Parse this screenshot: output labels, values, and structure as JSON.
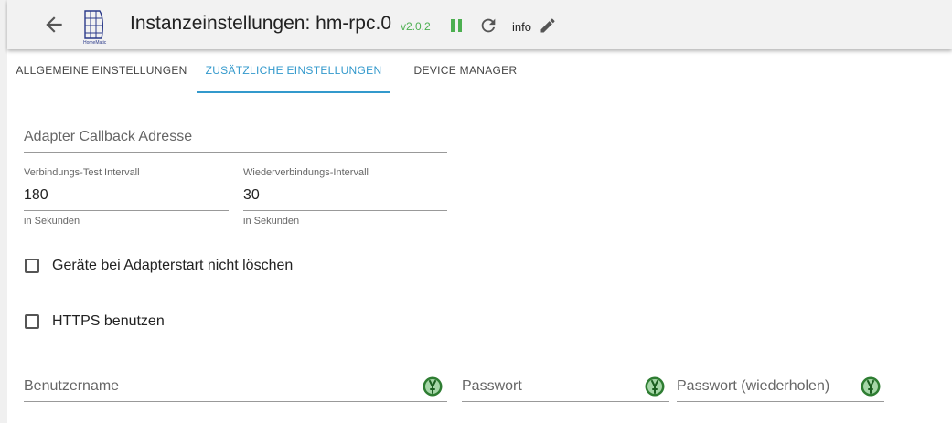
{
  "header": {
    "title": "Instanzeinstellungen: hm-rpc.0",
    "version": "v2.0.2",
    "info_label": "info",
    "version_color": "#4caf50",
    "logo_text": "HomeMatic"
  },
  "tabs": [
    {
      "label": "ALLGEMEINE EINSTELLUNGEN"
    },
    {
      "label": "ZUSÄTZLICHE EINSTELLUNGEN"
    },
    {
      "label": "DEVICE MANAGER"
    }
  ],
  "accent_color": "#3399cc",
  "fields": {
    "callback": {
      "placeholder": "Adapter Callback Adresse"
    },
    "check_interval": {
      "label": "Verbindungs-Test Intervall",
      "value": "180",
      "helper": "in Sekunden"
    },
    "reconnect_interval": {
      "label": "Wiederverbindungs-Intervall",
      "value": "30",
      "helper": "in Sekunden"
    },
    "username": {
      "placeholder": "Benutzername"
    },
    "password": {
      "placeholder": "Passwort"
    },
    "password_repeat": {
      "placeholder": "Passwort (wiederholen)"
    }
  },
  "checkboxes": {
    "dont_delete": {
      "label": "Geräte bei Adapterstart nicht löschen",
      "checked": false
    },
    "use_https": {
      "label": "HTTPS benutzen",
      "checked": false
    }
  }
}
